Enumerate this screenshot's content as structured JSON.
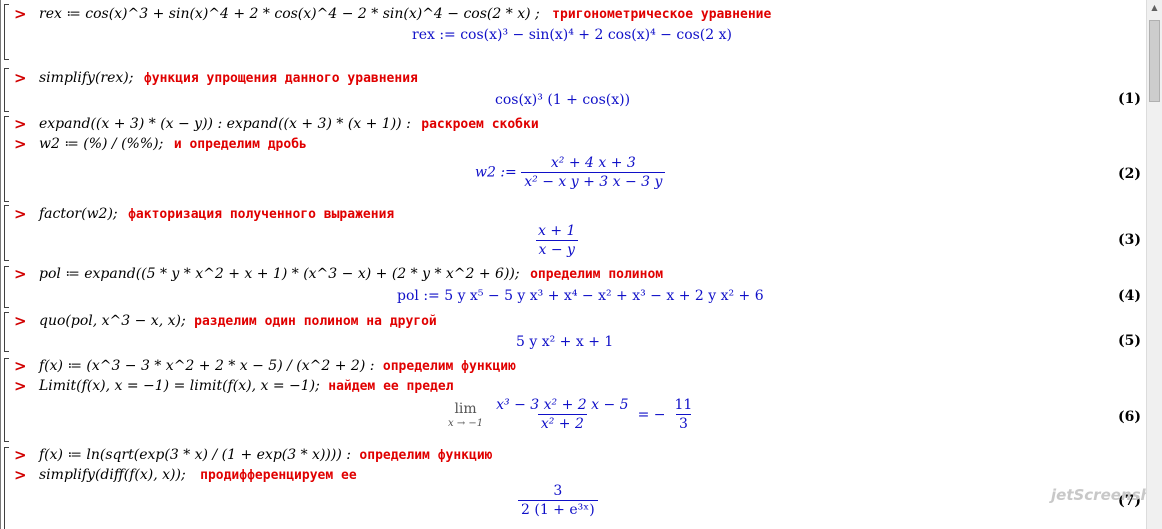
{
  "groups": [
    {
      "input": "rex ≔ cos(x)^3 + sin(x)^4 + 2 * cos(x)^4 − 2 * sin(x)^4 − cos(2 * x) ;",
      "comment": "тригонометрическое уравнение",
      "output": "rex := cos(x)³ − sin(x)⁴ + 2 cos(x)⁴ − cos(2 x)",
      "label": ""
    },
    {
      "input": "simplify(rex);",
      "comment": "функция упрощения данного уравнения",
      "output": "cos(x)³ (1 + cos(x))",
      "label": "(1)"
    },
    {
      "input": "expand((x + 3) * (x − y)) : expand((x + 3) * (x + 1)) :",
      "comment": "раскроем скобки",
      "output": "",
      "label": ""
    },
    {
      "input": "w2 ≔ (%) / (%%);",
      "comment": "и определим дробь",
      "output_lhs": "w2 :=",
      "output_num": "x² + 4 x + 3",
      "output_den": "x² − x y + 3 x − 3 y",
      "label": "(2)"
    },
    {
      "input": "factor(w2);",
      "comment": "факторизация полученного выражения",
      "output_num": "x + 1",
      "output_den": "x − y",
      "label": "(3)"
    },
    {
      "input": "pol ≔ expand((5 * y * x^2 + x + 1) * (x^3 − x) + (2 * y * x^2 + 6));",
      "comment": "определим полином",
      "output": "pol := 5 y x⁵ − 5 y x³ + x⁴ − x² + x³ − x + 2 y x² + 6",
      "label": "(4)"
    },
    {
      "input": "quo(pol, x^3 − x, x);",
      "comment": "разделим один полином на другой",
      "output": "5 y x² + x + 1",
      "label": "(5)"
    },
    {
      "input": "f(x) ≔ (x^3 − 3 * x^2 + 2 * x − 5) / (x^2 + 2) :",
      "comment": "определим функцию",
      "output": "",
      "label": ""
    },
    {
      "input": "Limit(f(x), x = −1) = limit(f(x), x = −1);",
      "comment": "найдем ее предел",
      "output_lim": "lim",
      "output_lim_sub": "x → −1",
      "output_num": "x³ − 3 x² + 2 x − 5",
      "output_den": "x² + 2",
      "output_rhs_sign": "= −",
      "output_rhs_num": "11",
      "output_rhs_den": "3",
      "label": "(6)"
    },
    {
      "input": "f(x) ≔ ln(sqrt(exp(3 * x) / (1 + exp(3 * x)))) :",
      "comment": "определим функцию",
      "output": "",
      "label": ""
    },
    {
      "input": "simplify(diff(f(x), x));",
      "comment": "продифференцируем ее",
      "output_num": "3",
      "output_den": "2 (1 + e³ˣ)",
      "label": "(7)"
    }
  ],
  "prompt_symbol": ">",
  "watermark": "jetScreenshot",
  "colors": {
    "prompt": "#d10000",
    "comment": "#e00000",
    "output": "#1010c8"
  }
}
